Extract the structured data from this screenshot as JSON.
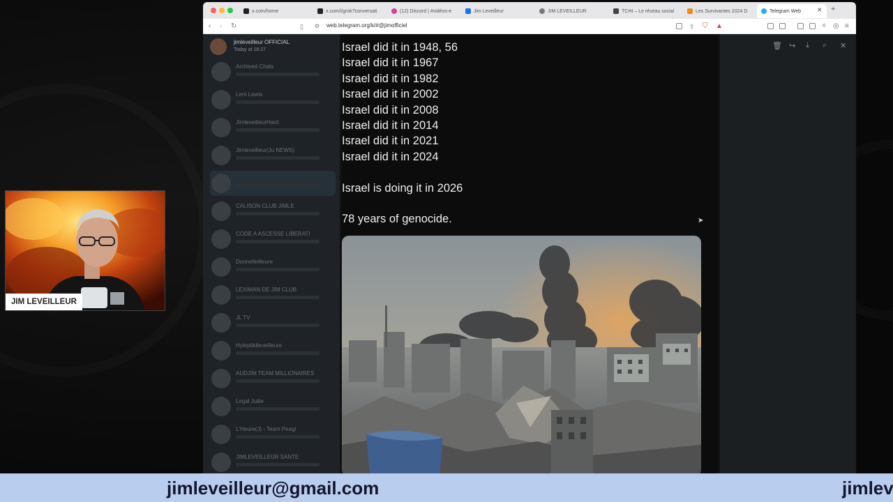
{
  "browser": {
    "tabs": [
      {
        "label": "x.com/home",
        "icon": "x-logo-icon",
        "color": "#222222"
      },
      {
        "label": "x.com/i/grok?conversati",
        "icon": "x-logo-icon",
        "color": "#222222"
      },
      {
        "label": "(12) Discord | #vidéos-e",
        "icon": "discord-icon",
        "color": "#d2459a"
      },
      {
        "label": "Jim Leveilleur",
        "icon": "facebook-icon",
        "color": "#1a73e8"
      },
      {
        "label": "JIM LEVEILLEUR",
        "icon": "user-icon",
        "color": "#666666"
      },
      {
        "label": "TCHI – Le réseau social",
        "icon": "page-icon",
        "color": "#444444"
      },
      {
        "label": "Les Survivantes 2024 D",
        "icon": "bookmark-icon",
        "color": "#f28c18"
      },
      {
        "label": "Telegram Web",
        "icon": "telegram-icon",
        "color": "#2aabee"
      }
    ],
    "active_tab": 7,
    "url": "web.telegram.org/k/#@jimofficiel"
  },
  "telegram": {
    "sender_name": "jimleveilleur OFFICIAL",
    "sender_time": "Today at 18:27",
    "chats": [
      "Archived Chats",
      "Lem Lewis",
      "JimleveilleurHard",
      "Jimleveilleur(Ju NEWS)",
      "",
      "CALISON CLUB JIMLE",
      "CODE A ASCESSE LIBERATI",
      "Donnelleilleure",
      "LEXIMAN DE JIM CLUB",
      "JL TV",
      "Hyleptiklleveilleure",
      "AUDJIM TEAM MILLIONAIRES",
      "Legal Juilie",
      "L'Heure(J) - Team Peagi",
      "JIMLEVEILLEUR SANTE"
    ],
    "selected_chat": 4
  },
  "post": {
    "lines": [
      "Israel did it in 1948, 56",
      "Israel did it in 1967",
      "Israel did it in 1982",
      "Israel did it in 2002",
      "Israel did it in 2008",
      "Israel did it in 2014",
      "Israel did it in 2021",
      "Israel did it in 2024"
    ],
    "line2": "Israel is doing it in 2026",
    "line3": "78 years of genocide."
  },
  "webcam": {
    "label": "JIM LEVEILLEUR"
  },
  "banner": {
    "email": "jimleveilleur@gmail.com",
    "email_partial": "jimlev"
  }
}
